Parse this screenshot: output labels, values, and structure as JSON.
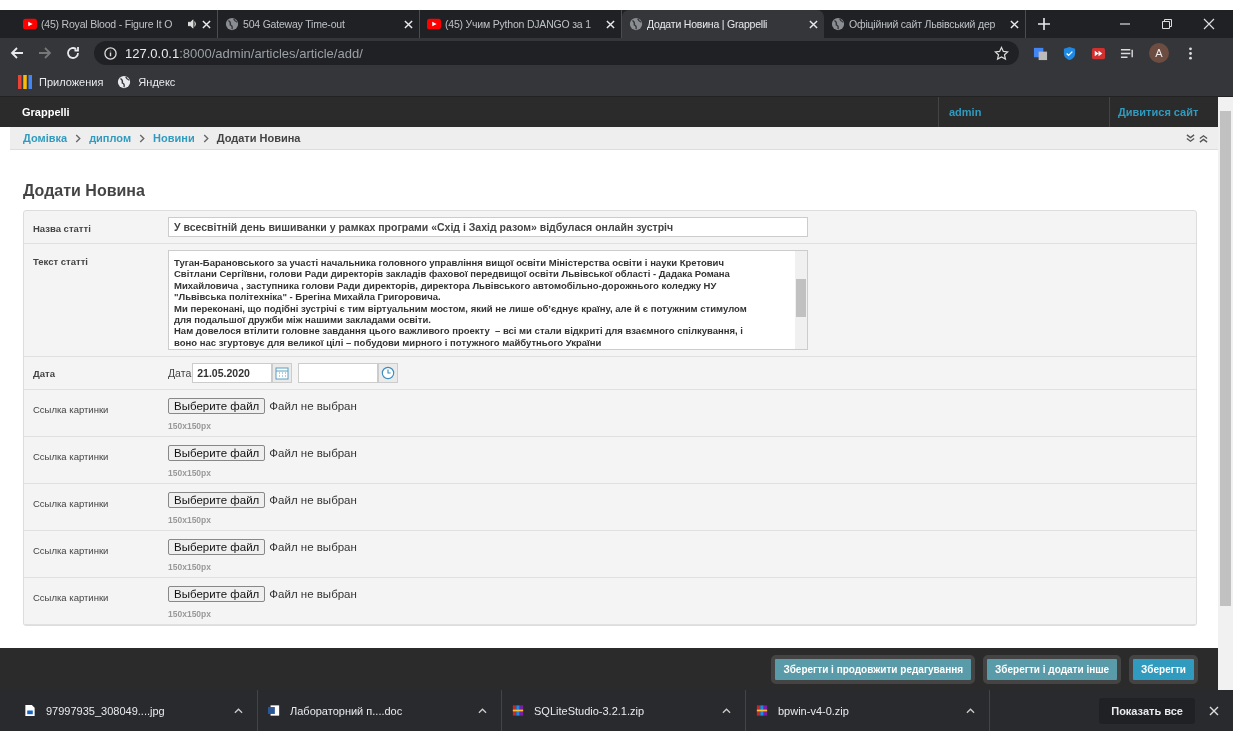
{
  "browser": {
    "tabs": [
      {
        "title": "(45) Royal Blood - Figure It O",
        "kind": "youtube",
        "audio": true,
        "selected": false
      },
      {
        "title": "504 Gateway Time-out",
        "kind": "globe",
        "audio": false,
        "selected": false
      },
      {
        "title": "(45) Учим Python DJANGO за 1",
        "kind": "youtube",
        "audio": false,
        "selected": false
      },
      {
        "title": "Додати Новина | Grappelli",
        "kind": "globe",
        "audio": false,
        "selected": true
      },
      {
        "title": "Офіційний сайт Львівський дер",
        "kind": "globe",
        "audio": false,
        "selected": false
      }
    ],
    "url_host": "127.0.0.1",
    "url_rest": ":8000/admin/articles/article/add/",
    "avatar": "A",
    "bookmarks": [
      {
        "label": "Приложения",
        "kind": "apps"
      },
      {
        "label": "Яндекс",
        "kind": "globe"
      }
    ]
  },
  "header": {
    "brand": "Grappelli",
    "user": "admin",
    "view_site": "Дивитися сайт"
  },
  "breadcrumbs": {
    "links": [
      "Домівка",
      "диплом",
      "Новини"
    ],
    "current": "Додати Новина"
  },
  "page_title": "Додати Новина",
  "fields": [
    {
      "kind": "text",
      "label": "Назва статті",
      "value": "У всесвітній день вишиванки у рамках програми «Схід і Захід разом» відбулася онлайн зустріч"
    },
    {
      "kind": "textarea",
      "label": "Текст статті",
      "value": "Туган-Барановського за участі начальника головного управління вищої освіти Міністерства освіти і науки Кретович\nСвітлани Сергіївни, голови Ради директорів закладів фахової передвищої освіти Львівської області - Дадака Романа\nМихайловича , заступника голови Ради директорів, директора Львівського автомобільно-дорожнього коледжу НУ\n\"Львівська політехніка\" - Брегіна Михайла Григоровича.\nМи переконані, що подібні зустрічі є тим віртуальним мостом, який не лише об’єднує країну, але й є потужним стимулом\nдля подальшої дружби між нашими закладами освіти.\nНам довелося втілити головне завдання цього важливого проекту  – всі ми стали відкриті для взаємного спілкування, і\nвоно нас згуртовує для великої цілі – побудови мирного і потужного майбутнього України"
    },
    {
      "kind": "datetime",
      "label": "Дата",
      "date_label": "Дата",
      "date": "21.05.2020"
    },
    {
      "kind": "file",
      "label": "Ссылка картинки",
      "button": "Выберите файл",
      "status": "Файл не выбран",
      "help": "150x150px"
    },
    {
      "kind": "file",
      "label": "Ссылка картинки",
      "button": "Выберите файл",
      "status": "Файл не выбран",
      "help": "150x150px"
    },
    {
      "kind": "file",
      "label": "Ссылка картинки",
      "button": "Выберите файл",
      "status": "Файл не выбран",
      "help": "150x150px"
    },
    {
      "kind": "file",
      "label": "Ссылка картинки",
      "button": "Выберите файл",
      "status": "Файл не выбран",
      "help": "150x150px"
    },
    {
      "kind": "file",
      "label": "Ссылка картинки",
      "button": "Выберите файл",
      "status": "Файл не выбран",
      "help": "150x150px"
    }
  ],
  "actions": [
    {
      "label": "Зберегти і продовжити редагування",
      "primary": false
    },
    {
      "label": "Зберегти і додати інше",
      "primary": false
    },
    {
      "label": "Зберегти",
      "primary": true
    }
  ],
  "downloads": {
    "items": [
      {
        "name": "97997935_308049....jpg",
        "kind": "image"
      },
      {
        "name": "Лабораторний п....doc",
        "kind": "doc"
      },
      {
        "name": "SQLiteStudio-3.2.1.zip",
        "kind": "zip"
      },
      {
        "name": "bpwin-v4-0.zip",
        "kind": "zip"
      }
    ],
    "show_all": "Показать все"
  }
}
